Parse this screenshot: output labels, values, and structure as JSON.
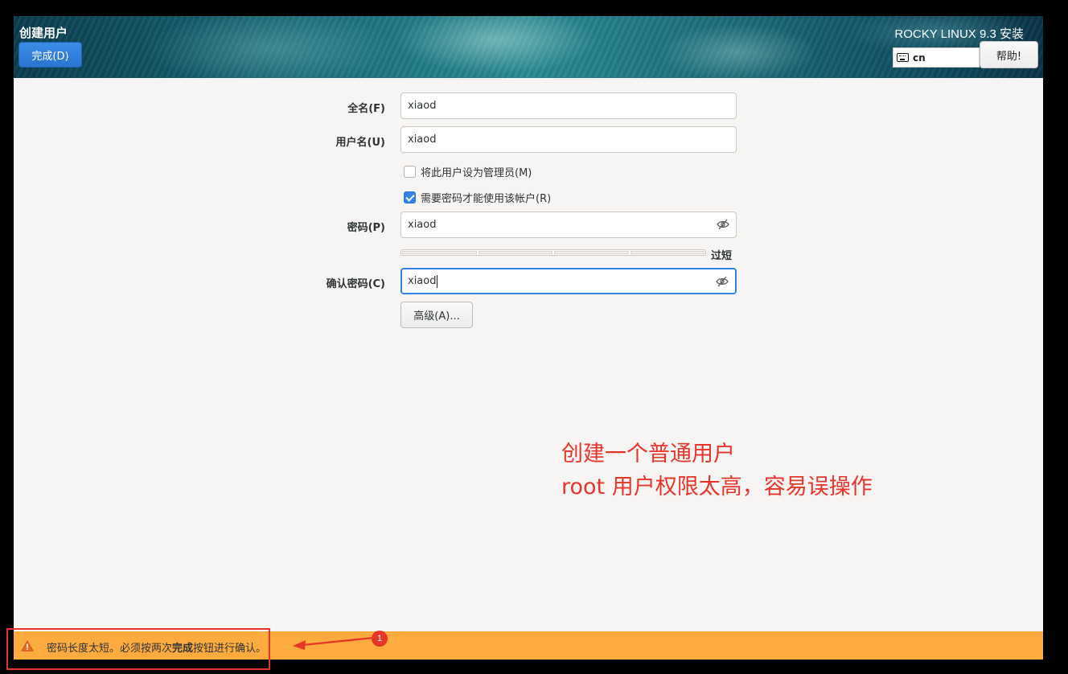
{
  "header": {
    "title": "创建用户",
    "done_label": "完成(D)",
    "product": "ROCKY LINUX 9.3 安装",
    "keyboard_layout": "cn",
    "help_label": "帮助!"
  },
  "form": {
    "fullname_label": "全名(F)",
    "fullname_value": "xiaod",
    "username_label": "用户名(U)",
    "username_value": "xiaod",
    "admin_checkbox_label": "将此用户设为管理员(M)",
    "admin_checked": false,
    "require_password_label": "需要密码才能使用该帐户(R)",
    "require_password_checked": true,
    "password_label": "密码(P)",
    "password_value": "xiaod",
    "strength_label": "过短",
    "confirm_label": "确认密码(C)",
    "confirm_value": "xiaod",
    "advanced_label": "高级(A)..."
  },
  "annotation": {
    "line1": "创建一个普通用户",
    "line2": "root 用户权限太高，容易误操作",
    "badge": "1"
  },
  "warning": {
    "text_before": "密码长度太短。必须按两次",
    "text_bold": "完成",
    "text_after": "按钮进行确认。"
  }
}
